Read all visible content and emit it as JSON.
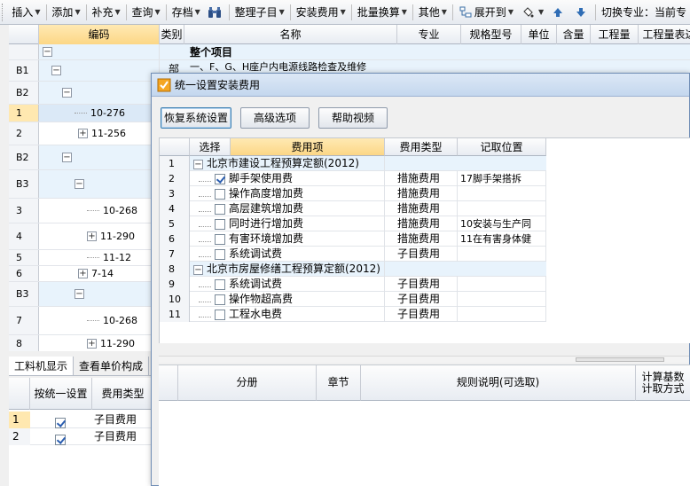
{
  "toolbar": {
    "insert": "插入",
    "add": "添加",
    "supplement": "补充",
    "query": "查询",
    "save": "存档",
    "organize": "整理子目",
    "install_fee": "安装费用",
    "batch_convert": "批量换算",
    "other": "其他",
    "expand_to": "展开到",
    "switch_major": "切换专业：当前专"
  },
  "grid": {
    "headers": {
      "code": "编码",
      "cat": "类别",
      "name": "名称",
      "major": "专业",
      "spec": "规格型号",
      "unit": "单位",
      "content": "含量",
      "qty": "工程量",
      "qty_expr": "工程量表达"
    },
    "top_name": "整个项目",
    "b1_cat": "部",
    "b1_name": "一、F、G、H座户内电源线路检查及维修",
    "rows": {
      "b1": "B1",
      "b2": "B2",
      "r1": "1",
      "r1c": "10-276",
      "r2": "2",
      "r2c": "11-256",
      "b2b": "B2",
      "b3": "B3",
      "r3": "3",
      "r3c": "10-268",
      "r4": "4",
      "r4c": "11-290",
      "r5": "5",
      "r5c": "11-12",
      "r6": "6",
      "r6c": "7-14",
      "b3b": "B3",
      "r7": "7",
      "r7c": "10-268",
      "r8": "8",
      "r8c": "11-290"
    }
  },
  "bottom_left": {
    "tab1": "工料机显示",
    "tab2": "查看单价构成",
    "col_unified": "按统一设置",
    "col_fee_type": "费用类型",
    "rows": [
      {
        "n": "1",
        "type": "子目费用",
        "checked": true
      },
      {
        "n": "2",
        "type": "子目费用",
        "checked": true
      }
    ]
  },
  "dialog": {
    "title": "统一设置安装费用",
    "btn_restore": "恢复系统设置",
    "btn_advanced": "高级选项",
    "btn_help": "帮助视频",
    "headers": {
      "select": "选择",
      "item": "费用项",
      "type": "费用类型",
      "location": "记取位置"
    },
    "rows": [
      {
        "n": "1",
        "name": "北京市建设工程预算定额(2012)",
        "group": true
      },
      {
        "n": "2",
        "name": "脚手架使用费",
        "checked": true,
        "type": "措施费用",
        "loc": "17脚手架搭拆"
      },
      {
        "n": "3",
        "name": "操作高度增加费",
        "checked": false,
        "type": "措施费用",
        "loc": ""
      },
      {
        "n": "4",
        "name": "高层建筑增加费",
        "checked": false,
        "type": "措施费用",
        "loc": ""
      },
      {
        "n": "5",
        "name": "同时进行增加费",
        "checked": false,
        "type": "措施费用",
        "loc": "10安装与生产同"
      },
      {
        "n": "6",
        "name": "有害环境增加费",
        "checked": false,
        "type": "措施费用",
        "loc": "11在有害身体健"
      },
      {
        "n": "7",
        "name": "系统调试费",
        "checked": false,
        "type": "子目费用",
        "loc": ""
      },
      {
        "n": "8",
        "name": "北京市房屋修缮工程预算定额(2012)",
        "group": true
      },
      {
        "n": "9",
        "name": "系统调试费",
        "checked": false,
        "type": "子目费用",
        "loc": ""
      },
      {
        "n": "10",
        "name": "操作物超高费",
        "checked": false,
        "type": "子目费用",
        "loc": ""
      },
      {
        "n": "11",
        "name": "工程水电费",
        "checked": false,
        "type": "子目费用",
        "loc": ""
      }
    ],
    "lower_headers": {
      "section": "分册",
      "chapter": "章节",
      "rule": "规则说明(可选取)",
      "calc": "计算基数\n计取方式"
    }
  },
  "colors": {
    "accent_header": "#fcd786",
    "group_row": "#e8f3fc",
    "title_bar": "#c4d7ee"
  }
}
